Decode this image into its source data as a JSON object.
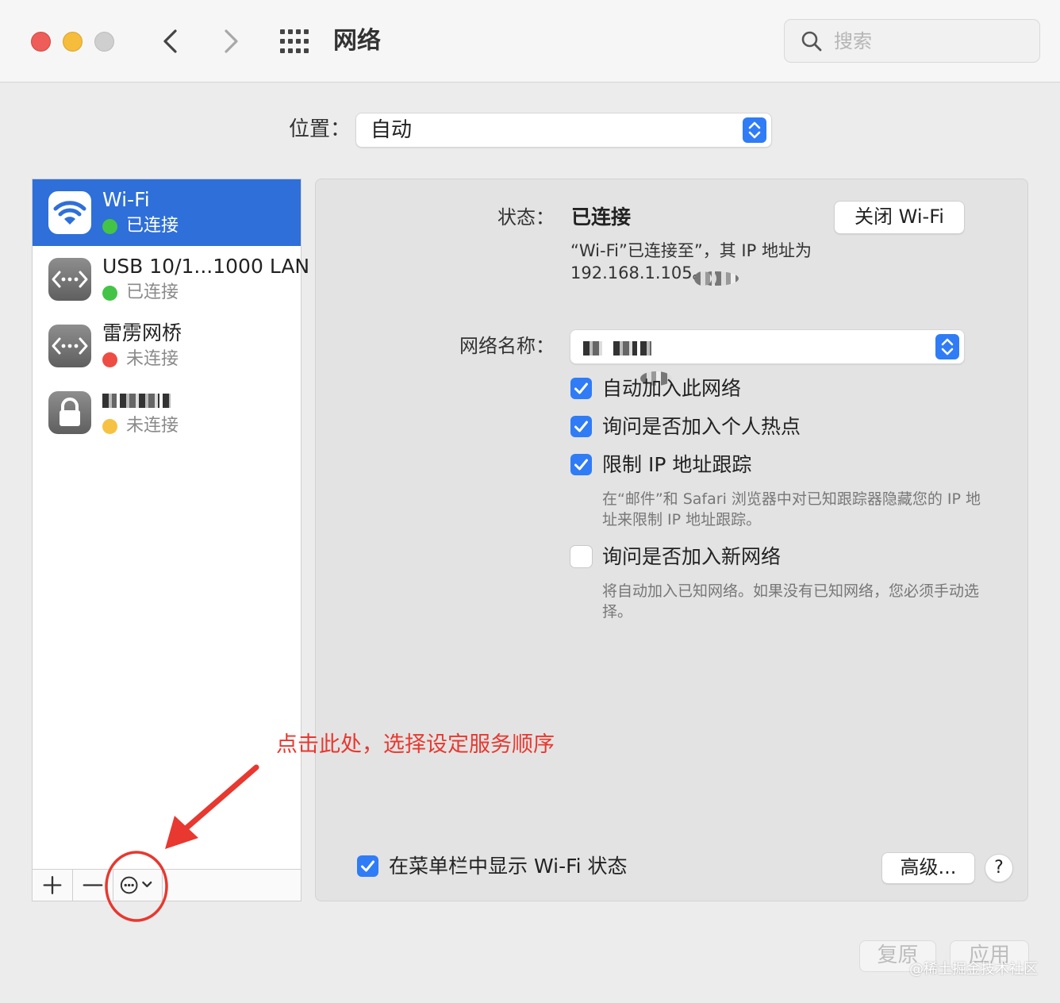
{
  "window": {
    "title": "网络",
    "search_placeholder": "搜索"
  },
  "location": {
    "label": "位置：",
    "value": "自动"
  },
  "services": [
    {
      "name": "Wi-Fi",
      "status": "已连接",
      "status_color": "#43c447",
      "icon": "wifi-icon",
      "selected": true
    },
    {
      "name": "USB 10/1...1000 LAN",
      "status": "已连接",
      "status_color": "#43c447",
      "icon": "ethernet-icon"
    },
    {
      "name": "雷雳网桥",
      "status": "未连接",
      "status_color": "#ee4d44",
      "icon": "ethernet-icon"
    },
    {
      "name": "",
      "status": "未连接",
      "status_color": "#f7c243",
      "icon": "lock-icon"
    }
  ],
  "toolbar": {
    "add": "+",
    "remove": "—"
  },
  "detail": {
    "status_label": "状态：",
    "status_value": "已连接",
    "turn_off_button": "关闭 Wi-Fi",
    "status_desc_prefix": "“Wi-Fi”已连接至",
    "status_desc_suffix": "”，其 IP 地址为",
    "ip_line": "192.168.1.105。",
    "network_name_label": "网络名称：",
    "options": [
      {
        "label": "自动加入此网络",
        "checked": true
      },
      {
        "label": "询问是否加入个人热点",
        "checked": true
      },
      {
        "label": "限制 IP 地址跟踪",
        "checked": true,
        "desc": "在“邮件”和 Safari 浏览器中对已知跟踪器隐藏您的 IP 地址来限制 IP 地址跟踪。"
      },
      {
        "label": "询问是否加入新网络",
        "checked": false,
        "desc": "将自动加入已知网络。如果没有已知网络，您必须手动选择。"
      }
    ],
    "show_in_menubar": "在菜单栏中显示 Wi-Fi 状态",
    "advanced_button": "高级...",
    "help_button": "?"
  },
  "footer": {
    "revert_button": "复原",
    "apply_button": "应用"
  },
  "annotation": {
    "text": "点击此处，选择设定服务顺序",
    "color": "#e8382f"
  },
  "watermark": "@稀土掘金技术社区",
  "colors": {
    "accent": "#2f7cf6",
    "selection": "#2e6fd9"
  }
}
